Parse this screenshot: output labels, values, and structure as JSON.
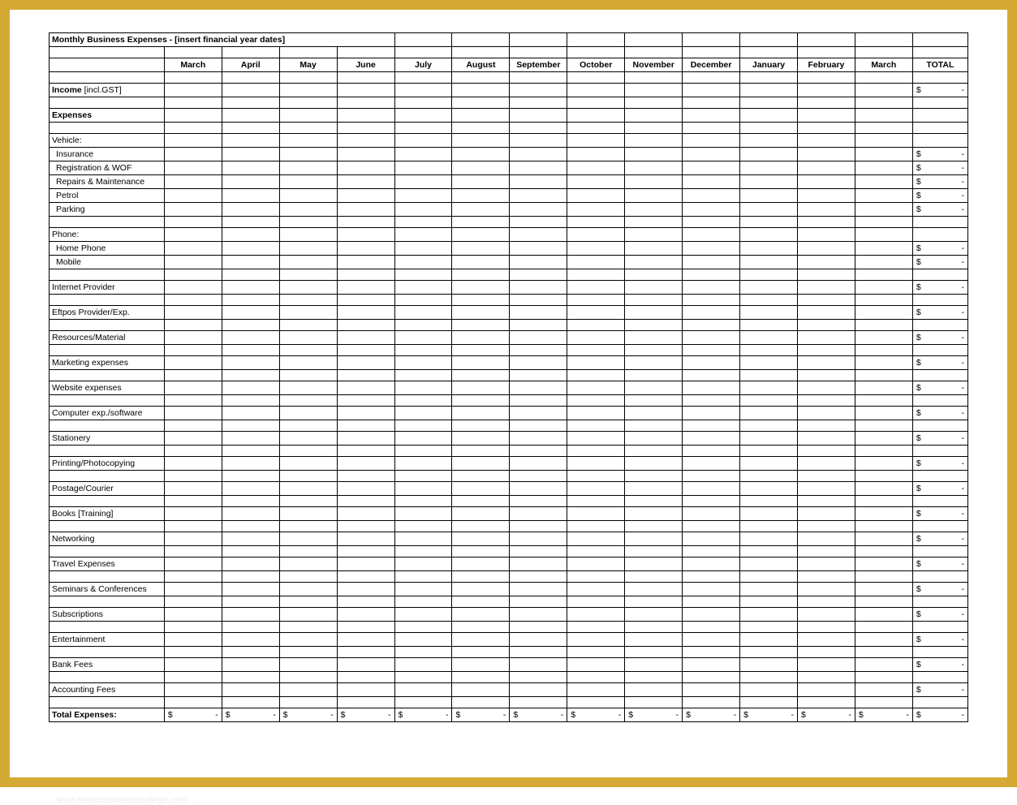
{
  "title": "Monthly Business Expenses - [insert financial year dates]",
  "columns": [
    "March",
    "April",
    "May",
    "June",
    "July",
    "August",
    "September",
    "October",
    "November",
    "December",
    "January",
    "February",
    "March",
    "TOTAL"
  ],
  "currency": "$",
  "dash": "-",
  "rows": [
    {
      "type": "blank"
    },
    {
      "type": "mixed",
      "label": "Income",
      "suffix": " [incl.GST]",
      "total": true
    },
    {
      "type": "blank"
    },
    {
      "type": "header",
      "label": "Expenses"
    },
    {
      "type": "blank"
    },
    {
      "type": "section",
      "label": "Vehicle:"
    },
    {
      "type": "item",
      "label": "Insurance",
      "total": true
    },
    {
      "type": "item",
      "label": "Registration & WOF",
      "total": true
    },
    {
      "type": "item",
      "label": "Repairs & Maintenance",
      "total": true
    },
    {
      "type": "item",
      "label": "Petrol",
      "total": true
    },
    {
      "type": "item",
      "label": "Parking",
      "total": true
    },
    {
      "type": "blank"
    },
    {
      "type": "section",
      "label": "Phone:"
    },
    {
      "type": "item",
      "label": "Home Phone",
      "total": true
    },
    {
      "type": "item",
      "label": "Mobile",
      "total": true
    },
    {
      "type": "blank"
    },
    {
      "type": "section",
      "label": "Internet Provider",
      "total": true
    },
    {
      "type": "blank"
    },
    {
      "type": "section",
      "label": "Eftpos Provider/Exp.",
      "total": true
    },
    {
      "type": "blank"
    },
    {
      "type": "section",
      "label": "Resources/Material",
      "total": true
    },
    {
      "type": "blank"
    },
    {
      "type": "section",
      "label": "Marketing expenses",
      "total": true
    },
    {
      "type": "blank"
    },
    {
      "type": "section",
      "label": "Website expenses",
      "total": true
    },
    {
      "type": "blank"
    },
    {
      "type": "section",
      "label": "Computer exp./software",
      "total": true
    },
    {
      "type": "blank"
    },
    {
      "type": "section",
      "label": "Stationery",
      "total": true
    },
    {
      "type": "blank"
    },
    {
      "type": "section",
      "label": "Printing/Photocopying",
      "total": true
    },
    {
      "type": "blank"
    },
    {
      "type": "section",
      "label": "Postage/Courier",
      "total": true
    },
    {
      "type": "blank"
    },
    {
      "type": "section",
      "label": "Books [Training]",
      "total": true
    },
    {
      "type": "blank"
    },
    {
      "type": "section",
      "label": "Networking",
      "total": true
    },
    {
      "type": "blank"
    },
    {
      "type": "section",
      "label": "Travel Expenses",
      "total": true
    },
    {
      "type": "blank"
    },
    {
      "type": "section",
      "label": "Seminars & Conferences",
      "total": true
    },
    {
      "type": "blank"
    },
    {
      "type": "section",
      "label": "Subscriptions",
      "total": true
    },
    {
      "type": "blank"
    },
    {
      "type": "section",
      "label": "Entertainment",
      "total": true
    },
    {
      "type": "blank"
    },
    {
      "type": "section",
      "label": "Bank Fees",
      "total": true
    },
    {
      "type": "blank"
    },
    {
      "type": "section",
      "label": "Accounting Fees",
      "total": true
    },
    {
      "type": "blank"
    },
    {
      "type": "totals",
      "label": "Total Expenses:"
    }
  ],
  "watermark": "www.heritagechristiancollege.com"
}
